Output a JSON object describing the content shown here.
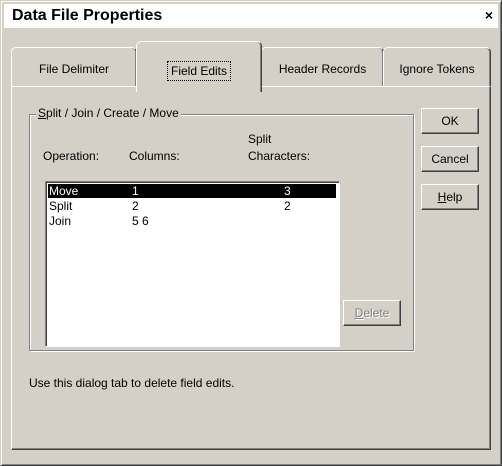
{
  "window": {
    "title": "Data File Properties",
    "close_label": "×"
  },
  "tabs": [
    {
      "label": "File Delimiter",
      "active": false
    },
    {
      "label": "Field Edits",
      "active": true
    },
    {
      "label": "Header Records",
      "active": false
    },
    {
      "label": "Ignore Tokens",
      "active": false
    }
  ],
  "group": {
    "label_accel": "S",
    "label_rest": "plit / Join / Create / Move"
  },
  "columns": {
    "operation": "Operation:",
    "columns": "Columns:",
    "split_line1": "Split",
    "split_line2": "Characters:"
  },
  "rows": [
    {
      "operation": "Move",
      "columns": "1",
      "split": "3",
      "selected": true
    },
    {
      "operation": "Split",
      "columns": "2",
      "split": "2",
      "selected": false
    },
    {
      "operation": "Join",
      "columns": "5 6",
      "split": "",
      "selected": false
    }
  ],
  "buttons": {
    "ok": "OK",
    "cancel": "Cancel",
    "help_accel": "H",
    "help_rest": "elp",
    "delete_accel": "D",
    "delete_rest": "elete"
  },
  "info_text": "Use this dialog tab to delete field edits."
}
